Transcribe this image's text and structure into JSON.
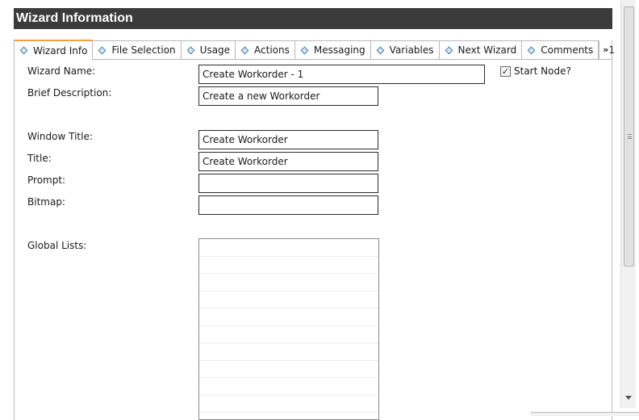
{
  "header": {
    "title": "Wizard Information"
  },
  "tabs": [
    {
      "label": "Wizard Info",
      "active": true
    },
    {
      "label": "File Selection",
      "active": false
    },
    {
      "label": "Usage",
      "active": false
    },
    {
      "label": "Actions",
      "active": false
    },
    {
      "label": "Messaging",
      "active": false
    },
    {
      "label": "Variables",
      "active": false
    },
    {
      "label": "Next Wizard",
      "active": false
    },
    {
      "label": "Comments",
      "active": false
    }
  ],
  "tab_overflow": {
    "chevron": "»",
    "count": "1"
  },
  "form": {
    "wizard_name_label": "Wizard Name:",
    "wizard_name_value": "Create Workorder - 1",
    "brief_description_label": "Brief Description:",
    "brief_description_value": "Create a new Workorder",
    "start_node_label": "Start Node?",
    "start_node_checked": true,
    "window_title_label": "Window Title:",
    "window_title_value": "Create Workorder",
    "title_label": "Title:",
    "title_value": "Create Workorder",
    "prompt_label": "Prompt:",
    "prompt_value": "",
    "bitmap_label": "Bitmap:",
    "bitmap_value": "",
    "global_lists_label": "Global Lists:",
    "global_lists_items": []
  },
  "icons": {
    "tab_icon": "diamond-icon",
    "checkbox_mark": "✓"
  }
}
